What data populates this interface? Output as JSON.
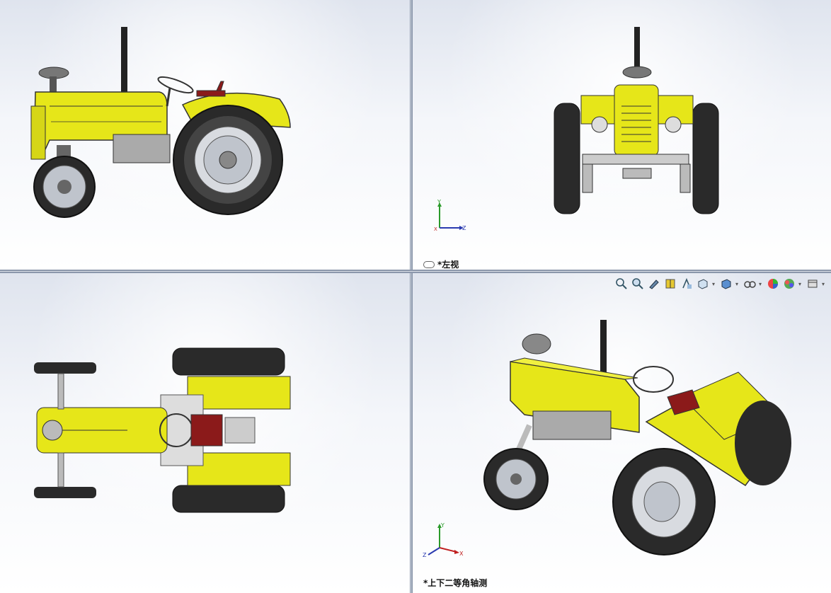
{
  "views": {
    "top_right": {
      "label": "*左视"
    },
    "bottom_right": {
      "label": "*上下二等角轴测"
    }
  },
  "triad": {
    "x": "X",
    "y": "Y",
    "z": "Z"
  },
  "toolbar": {
    "icons": [
      "zoom-to-fit-icon",
      "zoom-to-area-icon",
      "previous-view-icon",
      "section-view-icon",
      "dynamic-annotation-icon",
      "view-orientation-icon",
      "display-style-icon",
      "hide-show-icon",
      "edit-appearance-icon",
      "apply-scene-icon",
      "view-settings-icon"
    ]
  },
  "colors": {
    "body_yellow": "#e6e619",
    "seat_red": "#8b1a1a",
    "tire_dark": "#2a2a2a",
    "rim_grey": "#bfc4cc"
  }
}
